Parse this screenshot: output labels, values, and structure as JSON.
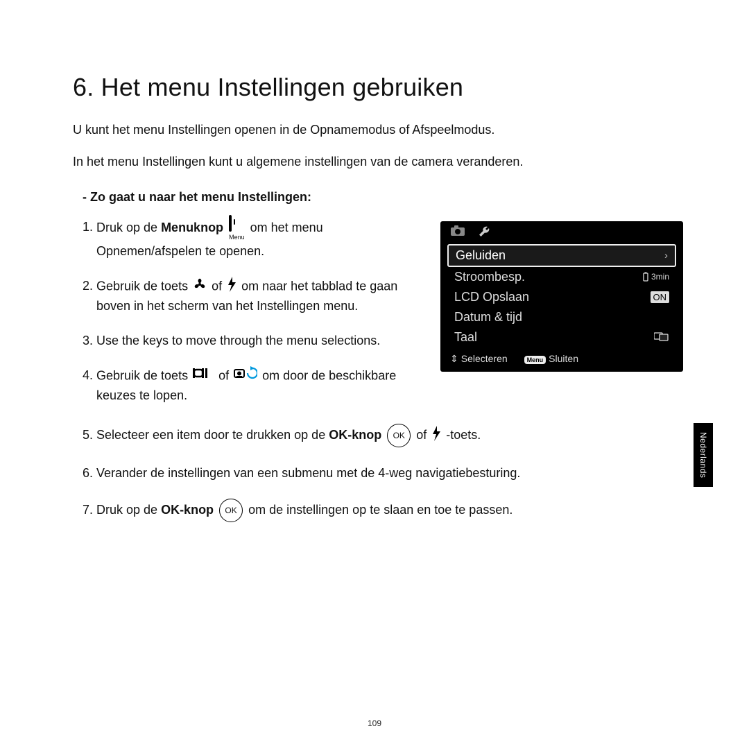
{
  "heading": "6. Het menu Instellingen gebruiken",
  "intro1": "U kunt het menu Instellingen openen in de Opnamemodus of Afspeelmodus.",
  "intro2": "In het menu Instellingen kunt u algemene instellingen van de camera veranderen.",
  "subheading": "- Zo gaat u naar het menu Instellingen:",
  "steps": {
    "s1a": "Druk op de ",
    "s1b": "Menuknop",
    "s1_menu_label": "Menu",
    "s1c": " om het menu Opnemen/afspelen te openen.",
    "s2a": "Gebruik de toets ",
    "s2_of": " of ",
    "s2b": " om naar het tabblad te gaan boven in het scherm van het Instellingen menu.",
    "s3": "Use the  keys to move through the menu selections.",
    "s4a": "Gebruik de toets ",
    "s4_of": " of ",
    "s4b": " om door de beschikbare keuzes te lopen.",
    "s5a": "Selecteer een item door te drukken op de ",
    "s5b": "OK-knop",
    "s5_ok": "OK",
    "s5_of": " of ",
    "s5c": " -toets.",
    "s6": "Verander de instellingen van een submenu met de 4-weg navigatiebesturing.",
    "s7a": "Druk op de ",
    "s7b": "OK-knop",
    "s7_ok": "OK",
    "s7c": " om de instellingen op te slaan en toe te passen."
  },
  "lcd": {
    "rows": [
      {
        "label": "Geluiden",
        "value": "›",
        "type": "arrow",
        "selected": true
      },
      {
        "label": "Stroombesp.",
        "value": "3min",
        "type": "batt",
        "selected": false
      },
      {
        "label": "LCD Opslaan",
        "value": "ON",
        "type": "pill",
        "selected": false
      },
      {
        "label": "Datum & tijd",
        "value": "",
        "type": "none",
        "selected": false
      },
      {
        "label": "Taal",
        "value": "⎚",
        "type": "lang",
        "selected": false
      }
    ],
    "foot_select": "Selecteren",
    "foot_close": "Sluiten",
    "foot_menu": "Menu"
  },
  "side_tab": "Nederlands",
  "page_number": "109"
}
